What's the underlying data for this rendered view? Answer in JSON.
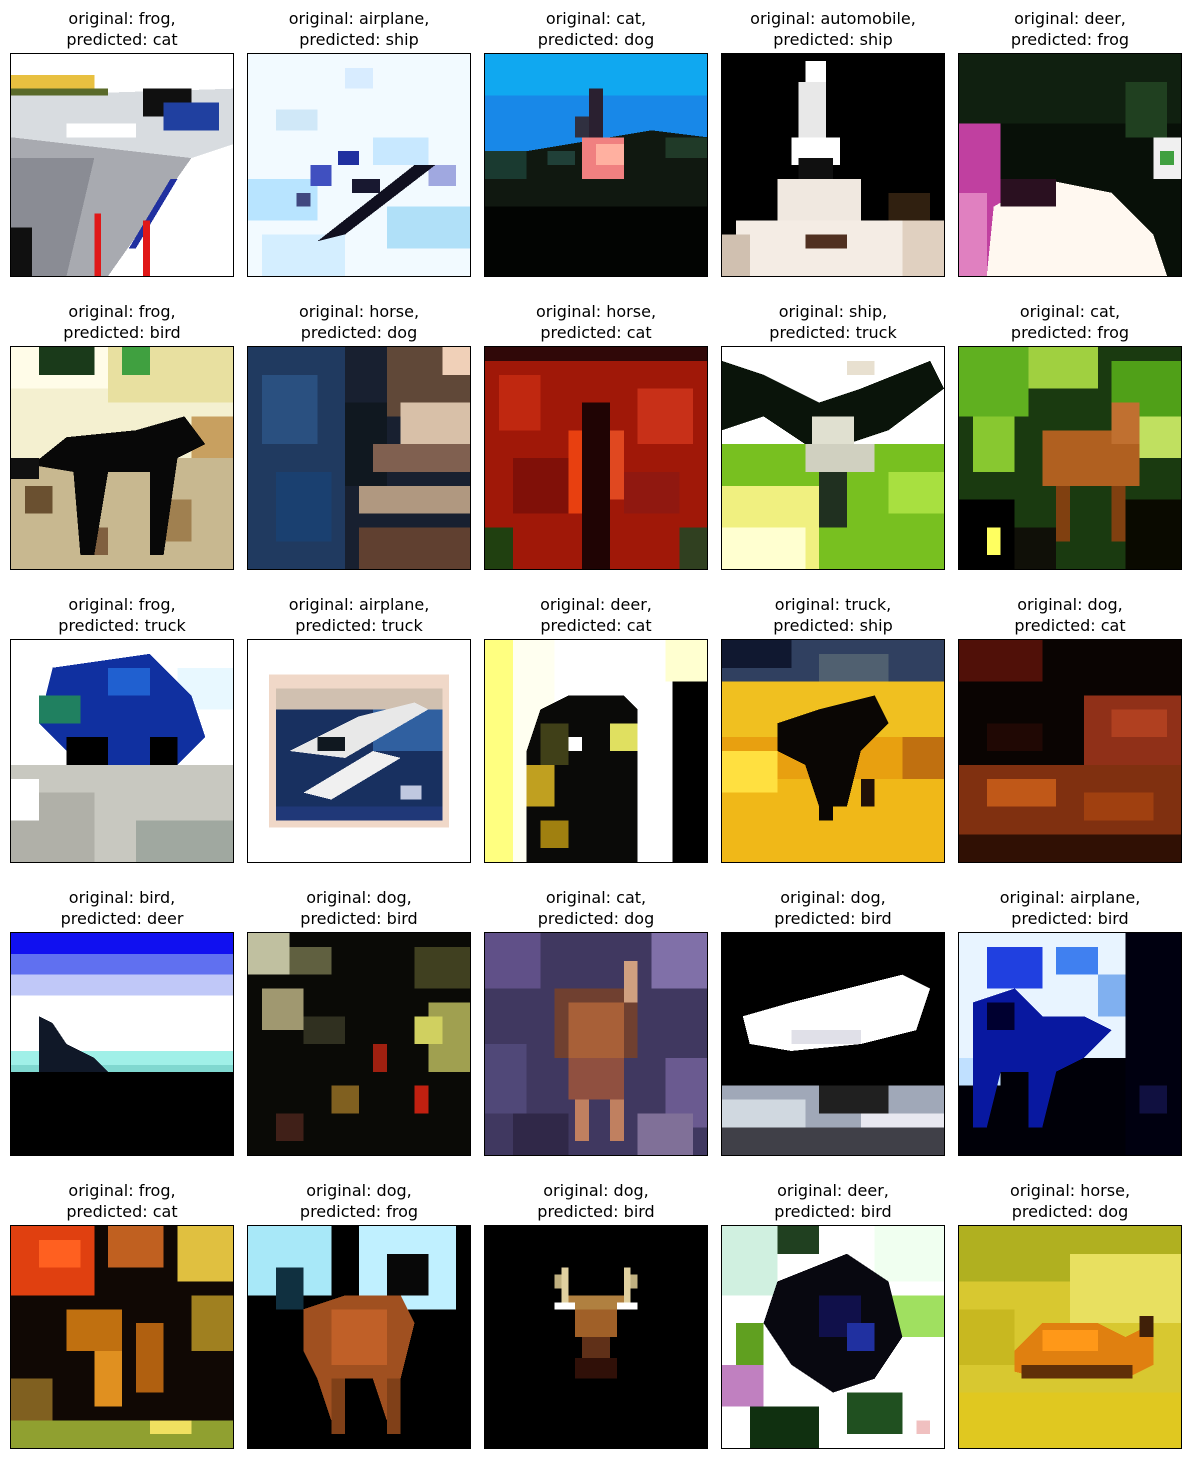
{
  "grid": [
    {
      "original": "original: frog,",
      "predicted": "predicted: cat",
      "image": "road-with-red-posts"
    },
    {
      "original": "original: airplane,",
      "predicted": "predicted: ship",
      "image": "white-sky-dark-plane"
    },
    {
      "original": "original: cat,",
      "predicted": "predicted: dog",
      "image": "blue-sky-bird-dark-ground"
    },
    {
      "original": "original: automobile,",
      "predicted": "predicted: ship",
      "image": "dark-dog-white-face"
    },
    {
      "original": "original: deer,",
      "predicted": "predicted: frog",
      "image": "black-bird-white-chest"
    },
    {
      "original": "original: frog,",
      "predicted": "predicted: bird",
      "image": "horse-silhouette-speckled"
    },
    {
      "original": "original: horse,",
      "predicted": "predicted: dog",
      "image": "blue-brown-blur"
    },
    {
      "original": "original: horse,",
      "predicted": "predicted: cat",
      "image": "red-texture"
    },
    {
      "original": "original: ship,",
      "predicted": "predicted: truck",
      "image": "bird-over-green-field"
    },
    {
      "original": "original: cat,",
      "predicted": "predicted: frog",
      "image": "deer-in-green-foliage"
    },
    {
      "original": "original: frog,",
      "predicted": "predicted: truck",
      "image": "blue-truck-gravel"
    },
    {
      "original": "original: airplane,",
      "predicted": "predicted: truck",
      "image": "framed-blue-plane"
    },
    {
      "original": "original: deer,",
      "predicted": "predicted: cat",
      "image": "cat-in-doorway"
    },
    {
      "original": "original: truck,",
      "predicted": "predicted: ship",
      "image": "horse-on-yellow-field"
    },
    {
      "original": "original: dog,",
      "predicted": "predicted: cat",
      "image": "dark-red-brown-texture"
    },
    {
      "original": "original: bird,",
      "predicted": "predicted: deer",
      "image": "ship-on-horizon"
    },
    {
      "original": "original: dog,",
      "predicted": "predicted: bird",
      "image": "dark-foliage-blur"
    },
    {
      "original": "original: cat,",
      "predicted": "predicted: dog",
      "image": "deer-in-purple-noise"
    },
    {
      "original": "original: dog,",
      "predicted": "predicted: bird",
      "image": "white-plane-dark"
    },
    {
      "original": "original: airplane,",
      "predicted": "predicted: bird",
      "image": "blue-deer-silhouette"
    },
    {
      "original": "original: frog,",
      "predicted": "predicted: cat",
      "image": "orange-red-blotches"
    },
    {
      "original": "original: dog,",
      "predicted": "predicted: frog",
      "image": "brown-deer-sky"
    },
    {
      "original": "original: dog,",
      "predicted": "predicted: bird",
      "image": "deer-head-antlers"
    },
    {
      "original": "original: deer,",
      "predicted": "predicted: bird",
      "image": "bird-in-white-leaves"
    },
    {
      "original": "original: horse,",
      "predicted": "predicted: dog",
      "image": "orange-animal-yellow"
    }
  ]
}
